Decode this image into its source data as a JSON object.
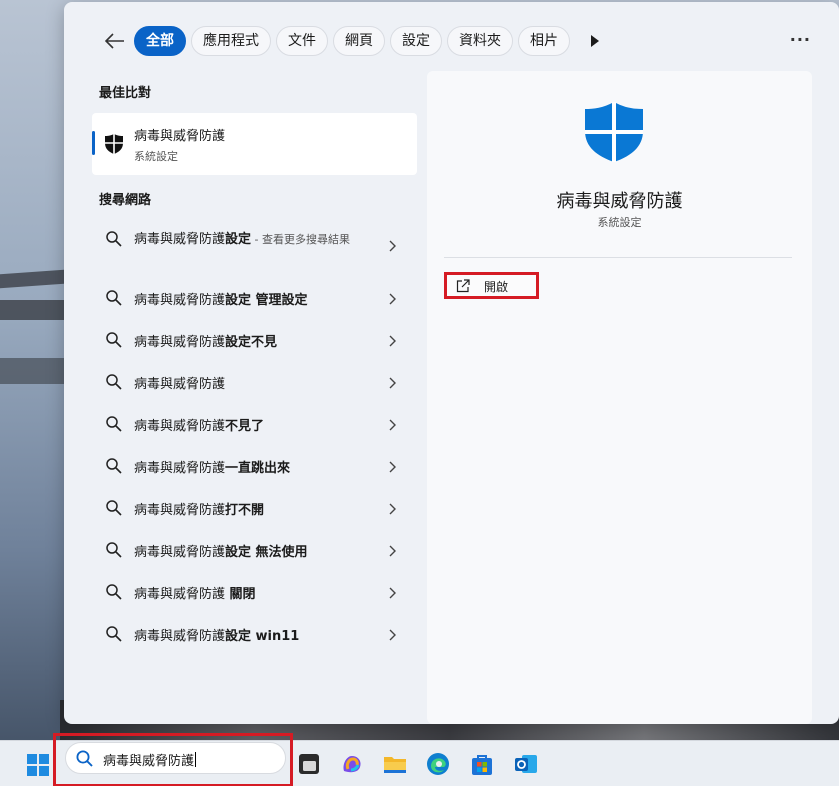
{
  "filters": {
    "back_icon": "back-arrow-icon",
    "chips": [
      {
        "label": "全部",
        "active": true
      },
      {
        "label": "應用程式",
        "active": false
      },
      {
        "label": "文件",
        "active": false
      },
      {
        "label": "網頁",
        "active": false
      },
      {
        "label": "設定",
        "active": false
      },
      {
        "label": "資料夾",
        "active": false
      },
      {
        "label": "相片",
        "active": false
      }
    ],
    "more_icon": "play-arrow-icon",
    "options_label": "···"
  },
  "best_match": {
    "section_title": "最佳比對",
    "title": "病毒與威脅防護",
    "subtitle": "系統設定",
    "icon": "shield-icon"
  },
  "web_search": {
    "section_title": "搜尋網路",
    "results": [
      {
        "prefix": "病毒與威脅防護",
        "bold": "設定",
        "suffix": " - 查看更多搜尋結果"
      },
      {
        "prefix": "病毒與威脅防護",
        "bold": "設定 管理設定",
        "suffix": ""
      },
      {
        "prefix": "病毒與威脅防護",
        "bold": "設定不見",
        "suffix": ""
      },
      {
        "prefix": "病毒與威脅防護",
        "bold": "",
        "suffix": ""
      },
      {
        "prefix": "病毒與威脅防護",
        "bold": "不見了",
        "suffix": ""
      },
      {
        "prefix": "病毒與威脅防護",
        "bold": "一直跳出來",
        "suffix": ""
      },
      {
        "prefix": "病毒與威脅防護",
        "bold": "打不開",
        "suffix": ""
      },
      {
        "prefix": "病毒與威脅防護",
        "bold": "設定 無法使用",
        "suffix": ""
      },
      {
        "prefix": "病毒與威脅防護",
        "bold": " 關閉",
        "suffix": ""
      },
      {
        "prefix": "病毒與威脅防護",
        "bold": "設定 win11",
        "suffix": ""
      }
    ]
  },
  "preview": {
    "title": "病毒與威脅防護",
    "subtitle": "系統設定",
    "open_label": "開啟",
    "accent_color": "#0a78d4"
  },
  "taskbar": {
    "search_text": "病毒與威脅防護",
    "apps": [
      "task-view-icon",
      "copilot-icon",
      "file-explorer-icon",
      "edge-icon",
      "microsoft-store-icon",
      "outlook-icon"
    ]
  },
  "colors": {
    "accent": "#0a63c7",
    "highlight_box": "#d51b24"
  }
}
